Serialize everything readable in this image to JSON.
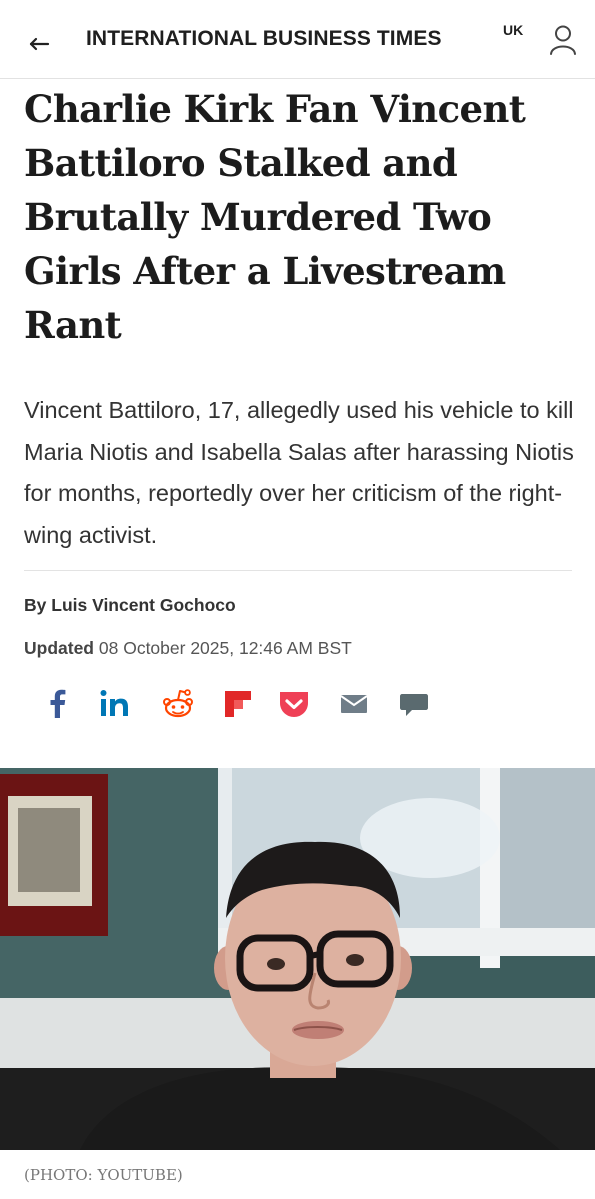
{
  "header": {
    "brand": "INTERNATIONAL BUSINESS TIMES",
    "edition": "UK",
    "back_icon": "back-arrow-icon",
    "user_icon": "user-icon"
  },
  "article": {
    "headline": "Charlie Kirk Fan Vincent Battiloro Stalked and Brutally Murdered Two Girls After a Livestream Rant",
    "standfirst": "Vincent Battiloro, 17, allegedly used his vehicle to kill Maria Niotis and Isabella Salas after harassing Niotis for months, reportedly over her criticism of the right-wing activist.",
    "byline_prefix": "By",
    "author": "Luis Vincent Gochoco",
    "updated_label": "Updated",
    "updated_value": "08 October 2025, 12:46 AM BST"
  },
  "share": {
    "items": [
      {
        "name": "facebook",
        "icon": "facebook-icon",
        "color": "#3b5998"
      },
      {
        "name": "linkedin",
        "icon": "linkedin-icon",
        "color": "#0077b5"
      },
      {
        "name": "reddit",
        "icon": "reddit-icon",
        "color": "#ff4500"
      },
      {
        "name": "flipboard",
        "icon": "flipboard-icon",
        "color": "#e12828"
      },
      {
        "name": "pocket",
        "icon": "pocket-icon",
        "color": "#ef4056"
      },
      {
        "name": "email",
        "icon": "email-icon",
        "color": "#6f7d88"
      },
      {
        "name": "comment",
        "icon": "comment-icon",
        "color": "#5a6a6f"
      }
    ]
  },
  "photo": {
    "caption": "(PHOTO: YOUTUBE)"
  }
}
